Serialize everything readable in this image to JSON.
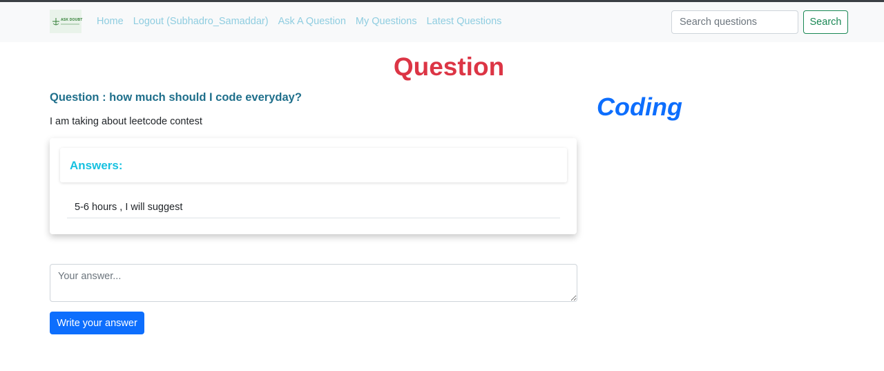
{
  "brand": {
    "logo_text": "ASK DOUBT"
  },
  "nav": {
    "links": [
      {
        "label": "Home"
      },
      {
        "label": "Logout (Subhadro_Samaddar)"
      },
      {
        "label": "Ask A Question"
      },
      {
        "label": "My Questions"
      },
      {
        "label": "Latest Questions"
      }
    ]
  },
  "search": {
    "placeholder": "Search questions",
    "value": "",
    "button_label": "Search"
  },
  "page": {
    "title": "Question"
  },
  "question": {
    "title": "Question : how much should I code everyday?",
    "body": "I am taking about leetcode contest",
    "category": "Coding"
  },
  "answers": {
    "heading": "Answers:",
    "items": [
      {
        "text": "5-6 hours , I will suggest"
      }
    ]
  },
  "answer_form": {
    "placeholder": "Your answer...",
    "value": "",
    "submit_label": "Write your answer"
  },
  "colors": {
    "title_red": "#dc3545",
    "nav_link": "#8fcde0",
    "question_title": "#1f6f8b",
    "category_blue": "#0d6efd",
    "answers_heading": "#17c1e0",
    "search_green": "#198754",
    "primary_button": "#0d6efd"
  }
}
